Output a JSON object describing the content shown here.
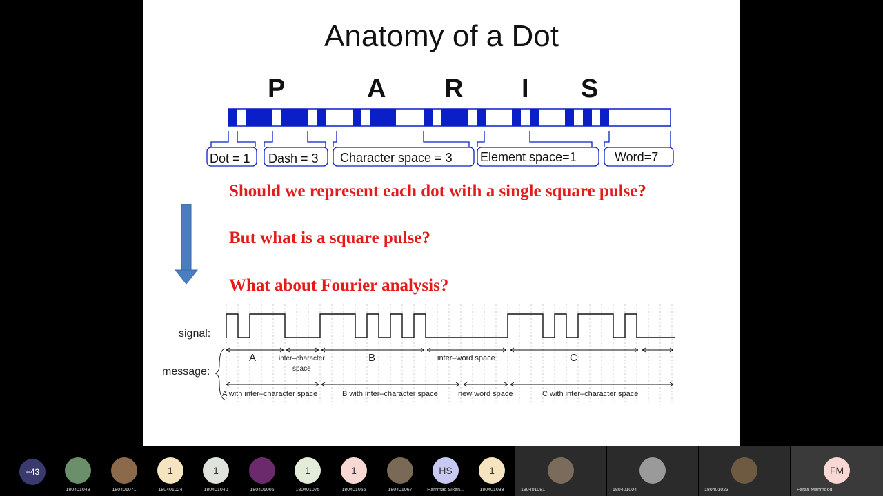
{
  "slide": {
    "title": "Anatomy of a Dot",
    "letters": [
      "P",
      "A",
      "R",
      "I",
      "S"
    ],
    "bracket_labels": [
      "Dot = 1",
      "Dash = 3",
      "Character space = 3",
      "Element space=1",
      "Word=7"
    ],
    "questions": [
      "Should we represent each dot with a single square pulse?",
      "But what is a square pulse?",
      "What about Fourier analysis?"
    ],
    "colors": {
      "morse_blue": "#0a1fc8",
      "question_red": "#e31b1b",
      "arrow_blue": "#4a7ec0"
    },
    "signal_diagram": {
      "signal_label": "signal:",
      "message_label": "message:",
      "top_labels": [
        "A",
        "inter–character",
        "space",
        "B",
        "inter–word space",
        "C"
      ],
      "bottom_labels": [
        "A with inter–character space",
        "B with inter–character space",
        "new word space",
        "C with inter–character space"
      ]
    }
  },
  "participants": {
    "more_count": "+43",
    "tiles": [
      {
        "initials": "",
        "name": "180401049",
        "color": "#6b8e6b"
      },
      {
        "initials": "",
        "name": "180401071",
        "color": "#8a6a4a"
      },
      {
        "initials": "1",
        "name": "180401024",
        "color": "#f6e3c0"
      },
      {
        "initials": "1",
        "name": "180401040",
        "color": "#dfe3dc"
      },
      {
        "initials": "",
        "name": "180401005",
        "color": "#6b2a6b"
      },
      {
        "initials": "1",
        "name": "180401075",
        "color": "#e3ecd8"
      },
      {
        "initials": "1",
        "name": "180401056",
        "color": "#f7d8d2"
      },
      {
        "initials": "",
        "name": "180401067",
        "color": "#7a6a55"
      },
      {
        "initials": "HS",
        "name": "Hammad Sikan...",
        "color": "#c7c9f2"
      },
      {
        "initials": "1",
        "name": "180401033",
        "color": "#f6e3c0"
      }
    ],
    "video_tiles": [
      {
        "name": "180401081"
      },
      {
        "name": "180401004"
      },
      {
        "name": "180401023"
      },
      {
        "initials": "FM",
        "name": "Faran Mahmood"
      }
    ]
  }
}
